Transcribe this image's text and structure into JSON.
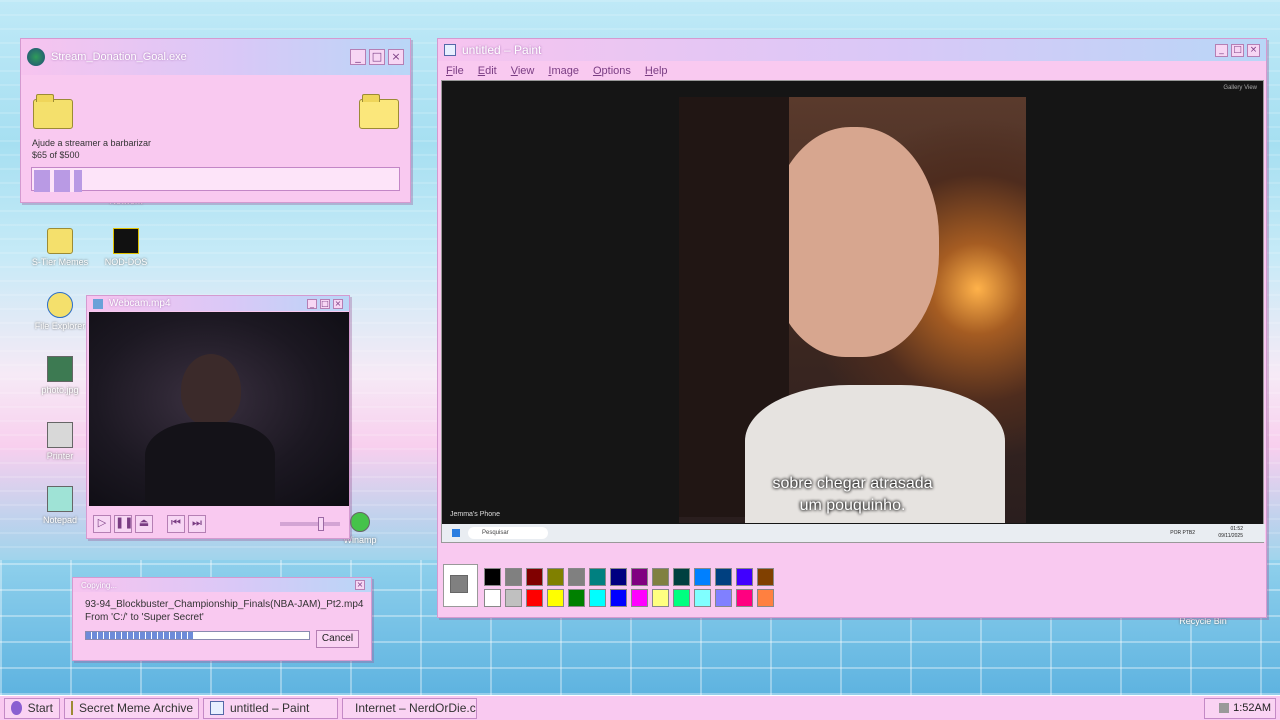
{
  "donation_window": {
    "title": "Stream_Donation_Goal.exe",
    "message": "Ajude a streamer a barbarizar",
    "progress_text": "$65 of $500",
    "progress_fraction": 0.13
  },
  "desktop_icons": [
    {
      "label": "Network"
    },
    {
      "label": "S-Tier Memes"
    },
    {
      "label": "NOD-DOS"
    },
    {
      "label": "File Explorer"
    },
    {
      "label": "photo.jpg"
    },
    {
      "label": "Printer"
    },
    {
      "label": "Notepad"
    },
    {
      "label": "Winamp"
    },
    {
      "label": "Recycle Bin"
    }
  ],
  "webcam_window": {
    "title": "Webcam.mp4"
  },
  "copy_dialog": {
    "title": "Copying...",
    "filename": "93-94_Blockbuster_Championship_Finals(NBA-JAM)_Pt2.mp4",
    "from_to": "From 'C:/' to 'Super Secret'",
    "progress_fraction": 0.48,
    "cancel_label": "Cancel"
  },
  "paint_window": {
    "title": "untitled – Paint",
    "menu": [
      "File",
      "Edit",
      "View",
      "Image",
      "Options",
      "Help"
    ],
    "canvas": {
      "gallery_view_label": "Gallery View",
      "subtitle_line1": "sobre chegar atrasada",
      "subtitle_line2": "um pouquinho.",
      "participant_label": "Jemma's Phone",
      "inner_search_placeholder": "Pesquisar",
      "inner_tray_lang": "POR PTB2",
      "inner_tray_time": "01:52",
      "inner_tray_date": "09/11/2025"
    },
    "palette": {
      "current_color": "#808080",
      "top_row": [
        "#000000",
        "#808080",
        "#800000",
        "#808000",
        "#808080",
        "#008080",
        "#000080",
        "#800080",
        "#808040",
        "#004040",
        "#0080ff",
        "#004080",
        "#4000ff",
        "#804000"
      ],
      "bottom_row": [
        "#ffffff",
        "#c0c0c0",
        "#ff0000",
        "#ffff00",
        "#008000",
        "#00ffff",
        "#0000ff",
        "#ff00ff",
        "#ffff80",
        "#00ff80",
        "#80ffff",
        "#8080ff",
        "#ff0080",
        "#ff8040"
      ]
    }
  },
  "taskbar": {
    "start_label": "Start",
    "items": [
      {
        "label": "Secret Meme Archive"
      },
      {
        "label": "untitled – Paint"
      },
      {
        "label": "Internet – NerdOrDie.com"
      }
    ],
    "clock": "1:52AM"
  }
}
